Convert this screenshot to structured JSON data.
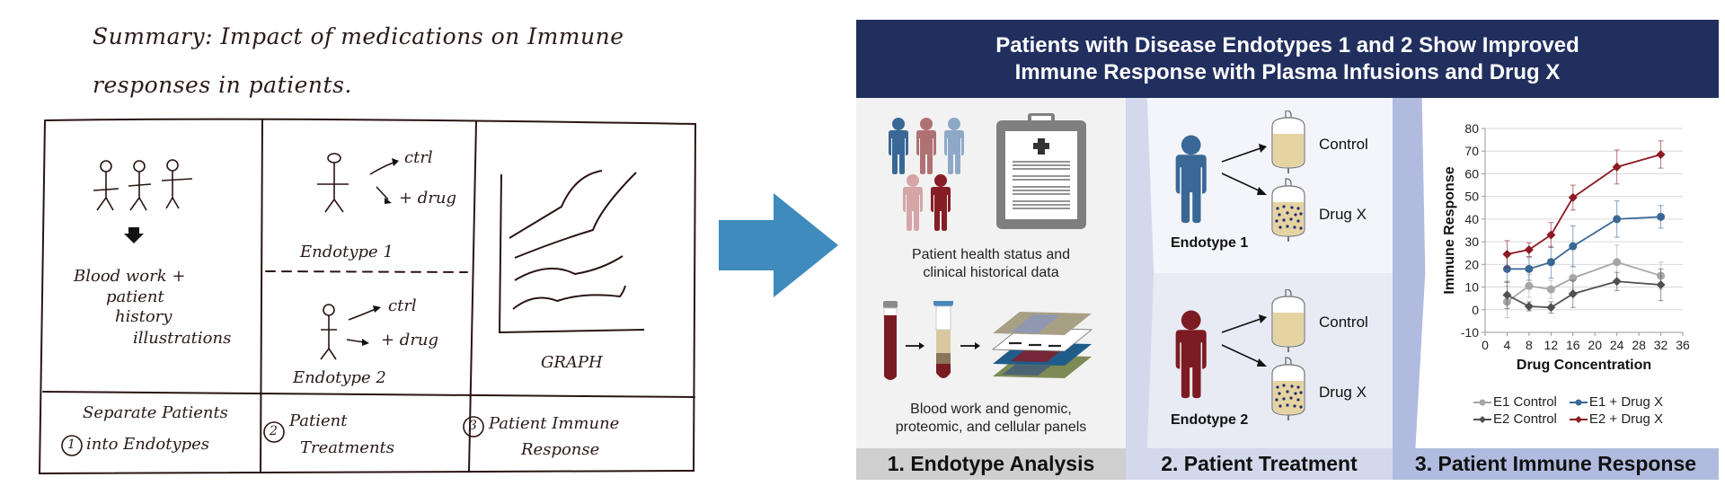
{
  "sketch": {
    "title_line1": "Summary: Impact of medications on Immune",
    "title_line2": "responses in patients.",
    "cell1_text": [
      "Blood work +",
      "patient",
      "history",
      "illustrations"
    ],
    "cell2_top_label": "Endotype 1",
    "cell2_bottom_label": "Endotype 2",
    "ctrl_label": "ctrl",
    "drug_label": "+ drug",
    "cell3_label": "GRAPH",
    "footer": [
      {
        "number": "1",
        "line1": "Separate Patients",
        "line2": "into Endotypes"
      },
      {
        "number": "2",
        "line1": "Patient",
        "line2": "Treatments"
      },
      {
        "number": "3",
        "line1": "Patient Immune",
        "line2": "Response"
      }
    ]
  },
  "arrow": {
    "icon": "right-arrow-icon",
    "color": "#3f8bbd"
  },
  "infographic": {
    "title_line1": "Patients with Disease Endotypes 1 and 2 Show Improved",
    "title_line2": "Immune Response with Plasma Infusions and Drug X",
    "panel1": {
      "caption_top_line1": "Patient health status and",
      "caption_top_line2": "clinical historical data",
      "caption_bottom_line1": "Blood work and genomic,",
      "caption_bottom_line2": "proteomic, and cellular panels",
      "footer": "1. Endotype Analysis"
    },
    "panel2": {
      "endotype1_label": "Endotype 1",
      "endotype2_label": "Endotype 2",
      "control_label": "Control",
      "drug_label": "Drug X",
      "footer": "2. Patient Treatment"
    },
    "panel3": {
      "footer": "3. Patient Immune Response"
    },
    "colors": {
      "header": "#212f5f",
      "endotype1": "#3a6896",
      "endotype2": "#7d1b22",
      "e1_control": "#a6a6a6",
      "e2_control": "#505050"
    }
  },
  "chart_data": {
    "type": "line",
    "title": "",
    "xlabel": "Drug Concentration",
    "ylabel": "Immune Response",
    "xlim": [
      0,
      36
    ],
    "ylim": [
      -10,
      80
    ],
    "xticks": [
      0,
      4,
      8,
      12,
      16,
      20,
      24,
      28,
      32,
      36
    ],
    "yticks": [
      -10,
      0,
      10,
      20,
      30,
      40,
      50,
      60,
      70,
      80
    ],
    "grid": "horizontal",
    "legend_position": "bottom",
    "x": [
      4,
      8,
      12,
      16,
      24,
      32
    ],
    "series": [
      {
        "name": "E1 Control",
        "color": "#a6a6a6",
        "marker": "circle",
        "values": [
          3.5,
          10.5,
          9,
          14,
          21,
          15
        ],
        "error": [
          7,
          5,
          4,
          5,
          7.5,
          6
        ]
      },
      {
        "name": "E1 + Drug X",
        "color": "#3a6896",
        "marker": "circle",
        "values": [
          18,
          18,
          21,
          28,
          40,
          41
        ],
        "error": [
          6,
          5,
          7,
          9,
          8,
          5
        ]
      },
      {
        "name": "E2 Control",
        "color": "#505050",
        "marker": "diamond",
        "values": [
          6.5,
          1.5,
          1,
          7,
          12.5,
          11
        ],
        "error": [
          6,
          2,
          2.5,
          6,
          4,
          7
        ]
      },
      {
        "name": "E2 + Drug X",
        "color": "#8b1a22",
        "marker": "diamond",
        "values": [
          24.5,
          26.5,
          33,
          49.5,
          63,
          68.5
        ],
        "error": [
          6,
          3,
          5.5,
          5.5,
          7.5,
          6
        ]
      }
    ]
  }
}
